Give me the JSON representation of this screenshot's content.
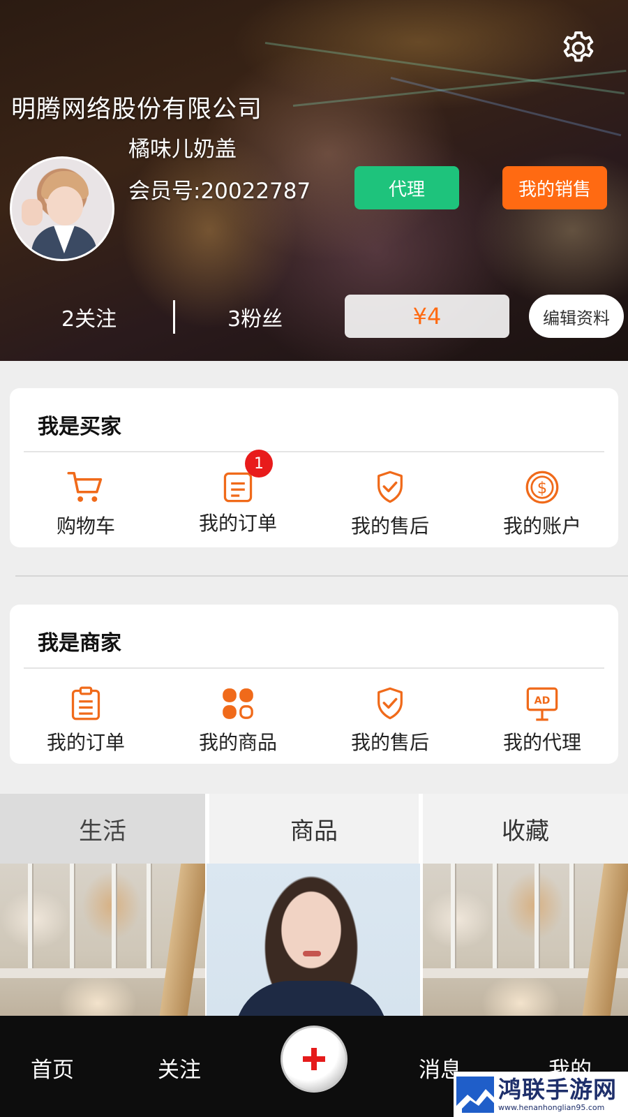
{
  "header": {
    "company_name": "明腾网络股份有限公司",
    "nickname": "橘味儿奶盖",
    "member_id": "会员号:20022787",
    "agent_button": "代理",
    "sales_button": "我的销售",
    "following": "2关注",
    "fans": "3粉丝",
    "balance": "¥4",
    "edit_profile": "编辑资料"
  },
  "buyer_section": {
    "title": "我是买家",
    "items": [
      {
        "label": "购物车",
        "icon": "shopping-cart-icon"
      },
      {
        "label": "我的订单",
        "icon": "order-list-icon",
        "badge": "1"
      },
      {
        "label": "我的售后",
        "icon": "shield-check-icon"
      },
      {
        "label": "我的账户",
        "icon": "dollar-coin-icon"
      }
    ]
  },
  "seller_section": {
    "title": "我是商家",
    "items": [
      {
        "label": "我的订单",
        "icon": "clipboard-icon"
      },
      {
        "label": "我的商品",
        "icon": "grid-apps-icon"
      },
      {
        "label": "我的售后",
        "icon": "shield-check-icon"
      },
      {
        "label": "我的代理",
        "icon": "ad-board-icon"
      }
    ]
  },
  "tabs": [
    {
      "label": "生活",
      "active": true
    },
    {
      "label": "商品",
      "active": false
    },
    {
      "label": "收藏",
      "active": false
    }
  ],
  "bottom_nav": {
    "home": "首页",
    "follow": "关注",
    "messages": "消息",
    "mine": "我的"
  },
  "watermark": {
    "title": "鸿联手游网",
    "url": "www.henanhonglian95.com"
  },
  "colors": {
    "accent": "#ff6a12",
    "icon_orange": "#f06a1a",
    "agent_green": "#1ec37c",
    "badge_red": "#e81b1b"
  }
}
